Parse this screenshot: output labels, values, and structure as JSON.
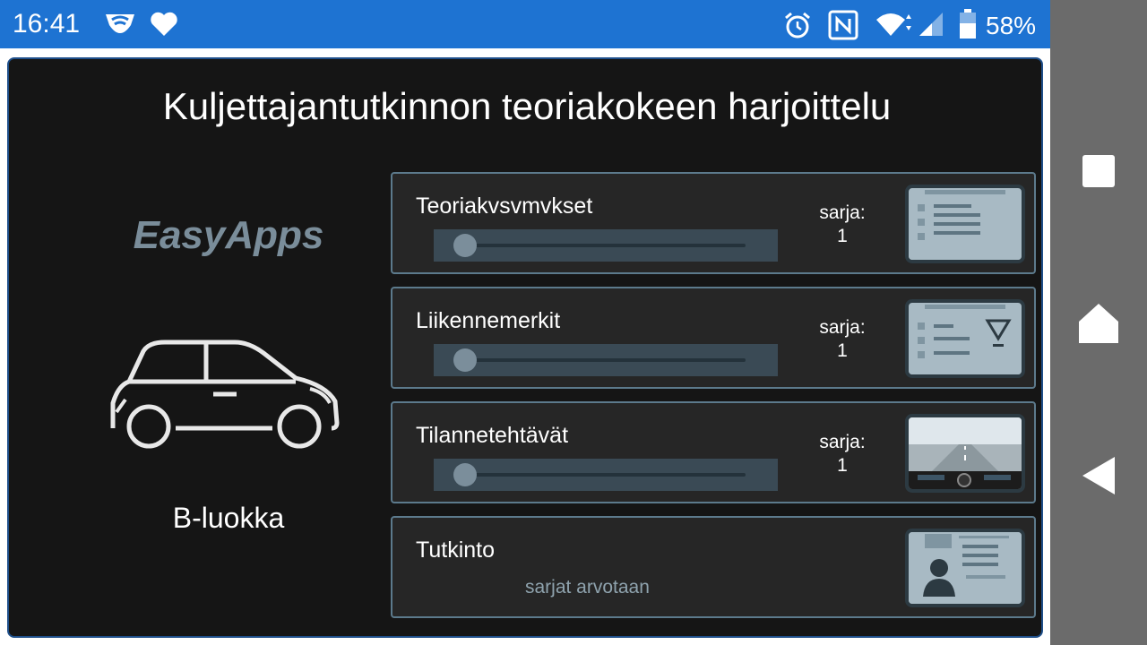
{
  "status_bar": {
    "time": "16:41",
    "battery": "58%",
    "icons": [
      "shield-wifi-icon",
      "heart-icon",
      "alarm-icon",
      "nfc-icon",
      "wifi-icon",
      "signal-icon",
      "battery-icon"
    ]
  },
  "nav_bar": {
    "icons": [
      "recent-apps-icon",
      "home-icon",
      "back-icon"
    ]
  },
  "app": {
    "title": "Kuljettajantutkinnon teoriakokeen harjoittelu",
    "brand": "EasyApps",
    "class_label": "B-luokka"
  },
  "categories": [
    {
      "label": "Teoriakvsvmvkset",
      "series_label": "sarja:",
      "series_value": "1",
      "progress": 0,
      "icon": "question-card-icon"
    },
    {
      "label": "Liikennemerkit",
      "series_label": "sarja:",
      "series_value": "1",
      "progress": 0,
      "icon": "traffic-sign-card-icon"
    },
    {
      "label": "Tilannetehtävät",
      "series_label": "sarja:",
      "series_value": "1",
      "progress": 0,
      "icon": "driving-view-icon"
    },
    {
      "label": "Tutkinto",
      "subtitle": "sarjat arvotaan",
      "icon": "id-card-icon"
    }
  ],
  "colors": {
    "status_bar": "#1e73d2",
    "card_bg": "#151515",
    "row_border": "#5c7a8c",
    "brand": "#7a8d9a"
  }
}
